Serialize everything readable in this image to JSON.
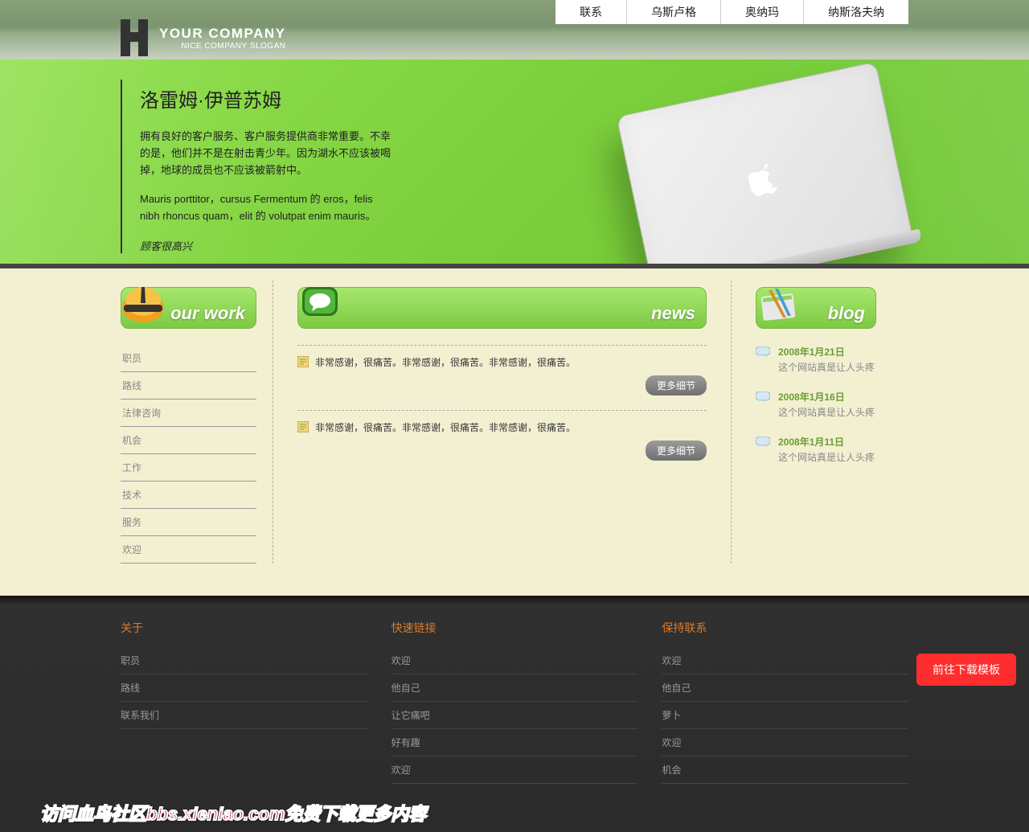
{
  "nav": [
    "联系",
    "乌斯卢格",
    "奥纳玛",
    "纳斯洛夫纳"
  ],
  "logo": {
    "company": "YOUR COMPANY",
    "slogan": "NICE COMPANY SLOGAN"
  },
  "hero": {
    "title": "洛雷姆·伊普苏姆",
    "p1": "拥有良好的客户服务、客户服务提供商非常重要。不幸的是，他们并不是在射击青少年。因为湖水不应该被喝掉，地球的成员也不应该被箭射中。",
    "p2": "Mauris porttitor，cursus Fermentum 的 eros，felis nibh rhoncus quam，elit 的 volutpat enim mauris。",
    "sign": "顾客很高兴"
  },
  "tabs": {
    "work": "our work",
    "news": "news",
    "blog": "blog"
  },
  "work_list": [
    "职员",
    "路线",
    "法律咨询",
    "机会",
    "工作",
    "技术",
    "服务",
    "欢迎"
  ],
  "news": {
    "items": [
      "非常感谢，很痛苦。非常感谢，很痛苦。非常感谢，很痛苦。",
      "非常感谢，很痛苦。非常感谢，很痛苦。非常感谢，很痛苦。"
    ],
    "more": "更多细节"
  },
  "blog": [
    {
      "date": "2008年1月21日",
      "txt": "这个网站真是让人头疼"
    },
    {
      "date": "2008年1月16日",
      "txt": "这个网站真是让人头疼"
    },
    {
      "date": "2008年1月11日",
      "txt": "这个网站真是让人头疼"
    }
  ],
  "footer": {
    "headings": [
      "关于",
      "快速链接",
      "保持联系"
    ],
    "cols": [
      [
        "职员",
        "路线",
        "联系我们"
      ],
      [
        "欢迎",
        "他自己",
        "让它痛吧",
        "好有趣",
        "欢迎"
      ],
      [
        "欢迎",
        "他自己",
        "萝卜",
        "欢迎",
        "机会"
      ]
    ]
  },
  "banner": "访问血鸟社区bbs.xieniao.com免费下载更多内容",
  "download_btn": "前往下载模板"
}
